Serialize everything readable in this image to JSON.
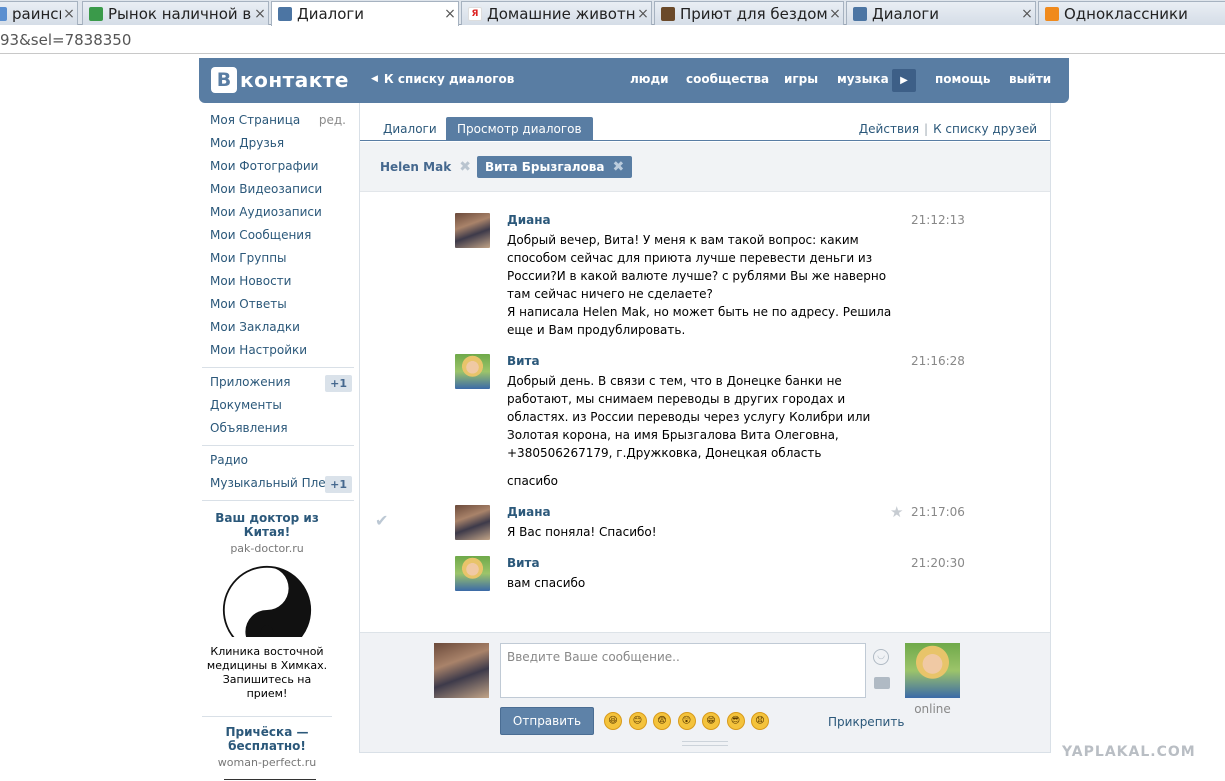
{
  "browser": {
    "tabs": [
      {
        "title": "раинск",
        "favicon_color": "#5b8fd0",
        "active": false
      },
      {
        "title": "Рынок наличной ва",
        "favicon_color": "#3a9a4a",
        "active": false
      },
      {
        "title": "Диалоги",
        "favicon_color": "#4c75a3",
        "active": true
      },
      {
        "title": "Домашние животны",
        "favicon_color": "#d22",
        "active": false
      },
      {
        "title": "Приют для бездомн",
        "favicon_color": "#6b4a2a",
        "active": false
      },
      {
        "title": "Диалоги",
        "favicon_color": "#4c75a3",
        "active": false
      },
      {
        "title": "Одноклассники",
        "favicon_color": "#f08a1c",
        "active": false
      }
    ],
    "url": "93&sel=7838350"
  },
  "header": {
    "logo_letter": "В",
    "logo_text": "контакте",
    "back_link": "К списку диалогов",
    "nav": [
      "люди",
      "сообщества",
      "игры",
      "музыка",
      "помощь",
      "выйти"
    ]
  },
  "left_menu": {
    "items_top": [
      {
        "label": "Моя Страница",
        "extra": "ред."
      },
      {
        "label": "Мои Друзья"
      },
      {
        "label": "Мои Фотографии"
      },
      {
        "label": "Мои Видеозаписи"
      },
      {
        "label": "Мои Аудиозаписи"
      },
      {
        "label": "Мои Сообщения"
      },
      {
        "label": "Мои Группы"
      },
      {
        "label": "Мои Новости"
      },
      {
        "label": "Мои Ответы"
      },
      {
        "label": "Мои Закладки"
      },
      {
        "label": "Мои Настройки"
      }
    ],
    "items_mid": [
      {
        "label": "Приложения",
        "badge": "+1"
      },
      {
        "label": "Документы"
      },
      {
        "label": "Объявления"
      }
    ],
    "items_bottom": [
      {
        "label": "Радио"
      },
      {
        "label": "Музыкальный Плеер",
        "badge": "+1"
      }
    ]
  },
  "ads": [
    {
      "title": "Ваш доктор из Китая!",
      "domain": "pak-doctor.ru",
      "text": "Клиника восточной медицины в Химках. Запишитесь на прием!"
    },
    {
      "title": "Причёска — бесплатно!",
      "domain": "woman-perfect.ru"
    }
  ],
  "dialog": {
    "tabs": [
      "Диалоги",
      "Просмотр диалогов"
    ],
    "right_links": [
      "Действия",
      "К списку друзей"
    ],
    "peers": [
      "Helen Mak",
      "Вита Брызгалова"
    ],
    "messages": [
      {
        "author": "Диана",
        "time": "21:12:13",
        "paragraphs": [
          "Добрый вечер, Вита! У меня к вам такой вопрос: каким способом сейчас для приюта лучше перевести деньги из России?И в какой валюте лучше? с рублями Вы же наверно там сейчас ничего не сделаете?",
          "Я написала Helen Mak, но может быть не по адресу. Решила еще и Вам продублировать."
        ]
      },
      {
        "author": "Вита",
        "time": "21:16:28",
        "paragraphs": [
          "Добрый день. В связи с тем, что в Донецке банки не работают, мы снимаем переводы в других городах и областях. из России переводы через услугу Колибри или Золотая корона, на имя Брызгалова Вита Олеговна, +380506267179, г.Дружковка, Донецкая область",
          "спасибо"
        ]
      },
      {
        "author": "Диана",
        "time": "21:17:06",
        "paragraphs": [
          "Я Вас поняла! Спасибо!"
        ]
      },
      {
        "author": "Вита",
        "time": "21:20:30",
        "paragraphs": [
          "вам спасибо"
        ]
      }
    ]
  },
  "composer": {
    "placeholder": "Введите Ваше сообщение..",
    "send_label": "Отправить",
    "attach_label": "Прикрепить",
    "peer_status": "online",
    "emojis": [
      "😆",
      "😊",
      "😨",
      "😲",
      "😁",
      "😎",
      "😧"
    ]
  },
  "watermark": "YAPLAKAL.COM"
}
